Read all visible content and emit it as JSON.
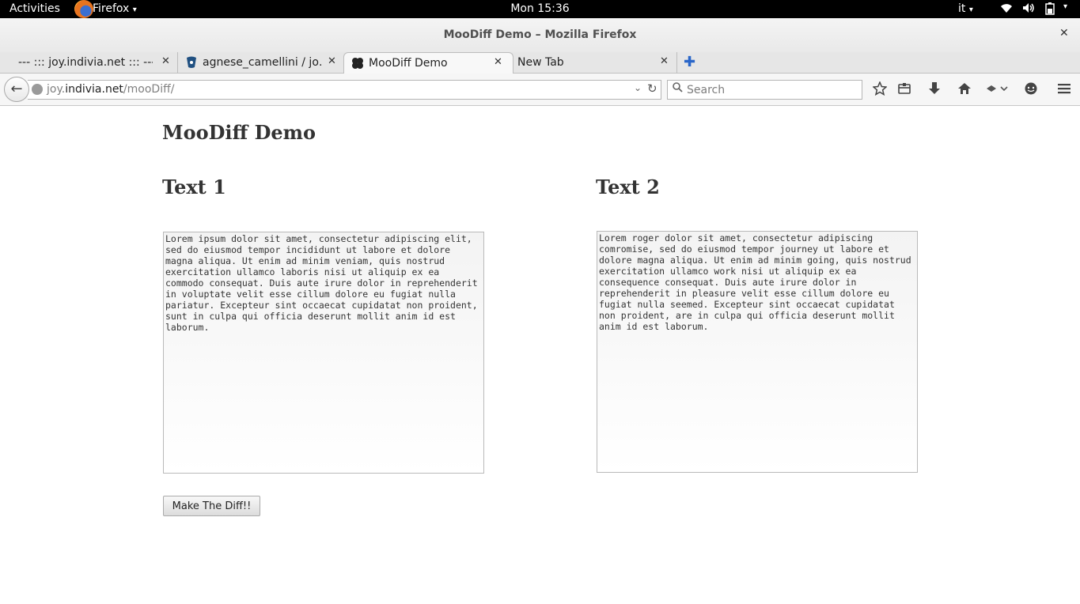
{
  "system_bar": {
    "activities": "Activities",
    "app_name": "Firefox",
    "app_menu_arrow": "▾",
    "clock": "Mon 15:36",
    "language": "it",
    "language_arrow": "▾",
    "tray_arrow": "▾"
  },
  "window": {
    "title": "MooDiff Demo – Mozilla Firefox",
    "close_glyph": "✕"
  },
  "tabs": [
    {
      "label": "--- ::: joy.indivia.net ::: ---",
      "close": "✕",
      "icon": "none"
    },
    {
      "label": "agnese_camellini / jo…",
      "close": "✕",
      "icon": "bitbucket-icon"
    },
    {
      "label": "MooDiff Demo",
      "close": "✕",
      "icon": "clover-icon",
      "active": true
    },
    {
      "label": "New Tab",
      "close": "✕",
      "icon": "none"
    }
  ],
  "new_tab_glyph": "✚",
  "navbar": {
    "back_glyph": "←",
    "url_host_prefix": "joy.",
    "url_host": "indivia.net",
    "url_path": "/mooDiff/",
    "dropdown_glyph": "⌄",
    "reload_glyph": "↻",
    "search_placeholder": "Search",
    "search_glyph": "⌕"
  },
  "toolbar_icons": [
    "star-icon",
    "reading-list-icon",
    "download-icon",
    "home-icon",
    "extension-icon",
    "chat-icon",
    "menu-icon"
  ],
  "page": {
    "heading": "MooDiff Demo",
    "text1_heading": "Text 1",
    "text2_heading": "Text 2",
    "text1_value": "Lorem ipsum dolor sit amet, consectetur adipiscing elit, sed do eiusmod tempor incididunt ut labore et dolore magna aliqua. Ut enim ad minim veniam, quis nostrud exercitation ullamco laboris nisi ut aliquip ex ea commodo consequat. Duis aute irure dolor in reprehenderit in voluptate velit esse cillum dolore eu fugiat nulla pariatur. Excepteur sint occaecat cupidatat non proident, sunt in culpa qui officia deserunt mollit anim id est laborum.",
    "text2_value": "Lorem roger dolor sit amet, consectetur adipiscing comromise, sed do eiusmod tempor journey ut labore et dolore magna aliqua. Ut enim ad minim going, quis nostrud exercitation ullamco work nisi ut aliquip ex ea consequence consequat. Duis aute irure dolor in reprehenderit in pleasure velit esse cillum dolore eu fugiat nulla seemed. Excepteur sint occaecat cupidatat non proident, are in culpa qui officia deserunt mollit anim id est laborum.",
    "button_label": "Make The Diff!!"
  }
}
